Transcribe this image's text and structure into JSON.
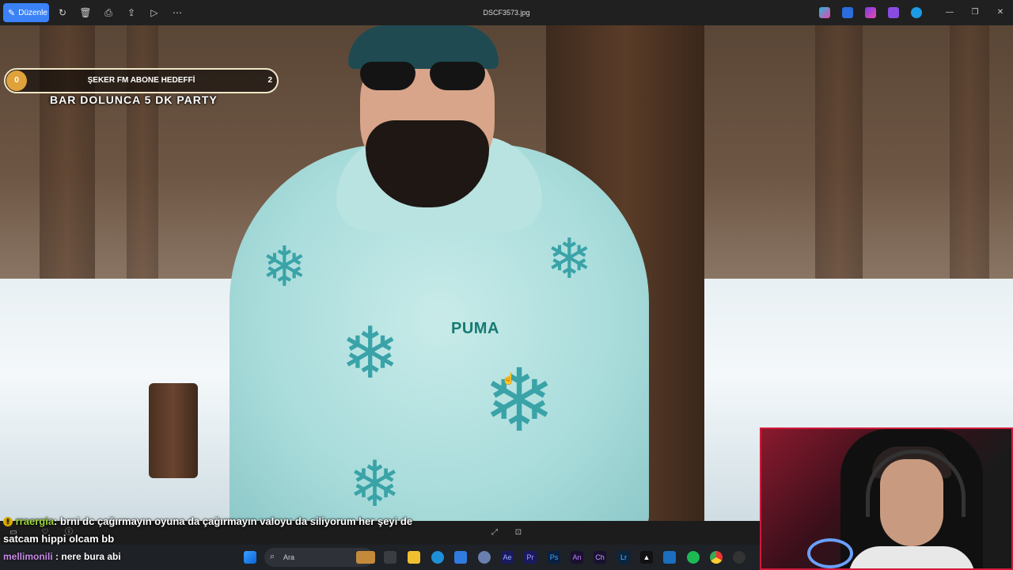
{
  "titlebar": {
    "edit_label": "Düzenle",
    "filename": "DSCF3573.jpg"
  },
  "goal": {
    "start": "0",
    "label": "ŞEKER FM ABONE HEDEFFİ",
    "end": "2",
    "sub": "BAR DOLUNCA 5 DK PARTY"
  },
  "photo": {
    "brand_text": "PUMA"
  },
  "chat": {
    "msg1_user": "rraergia",
    "msg1_sep": ": ",
    "msg1_text": "brni dc çağırmayın oyuna da çağırmayın valoyu da siliyorum her şeyi de satcam hippi olcam bb",
    "msg2_user": "mellimonili",
    "msg2_sep": " : ",
    "msg2_text": "nere bura abi"
  },
  "taskbar": {
    "search_placeholder": "Ara"
  },
  "colors": {
    "accent": "#3b82f6",
    "titlebar_bg": "#202020",
    "goal_start": "#e0a23a",
    "chat_user1": "#9ad23c",
    "chat_user2": "#c98ae6"
  }
}
